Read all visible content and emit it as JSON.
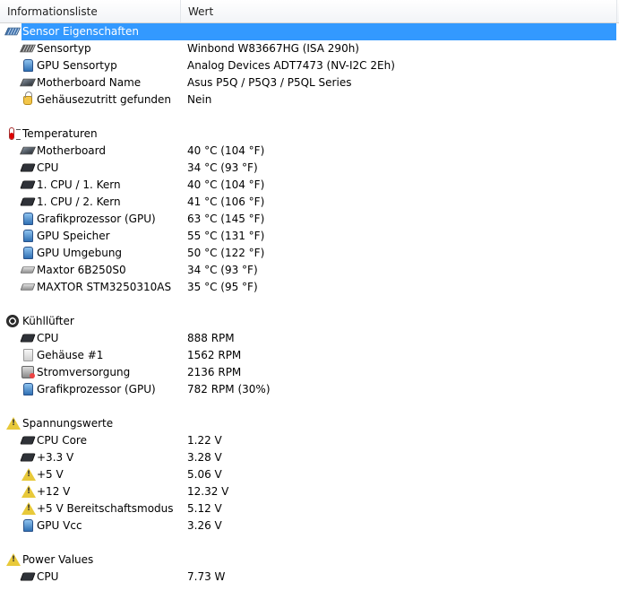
{
  "header": {
    "col_field": "Informationsliste",
    "col_value": "Wert"
  },
  "sections": [
    {
      "title": "Sensor Eigenschaften",
      "icon": "sensor-icon",
      "selected": true,
      "items": [
        {
          "label": "Sensortyp",
          "value": "Winbond W83667HG  (ISA 290h)",
          "icon": "sensor-chip-icon"
        },
        {
          "label": "GPU Sensortyp",
          "value": "Analog Devices ADT7473  (NV-I2C 2Eh)",
          "icon": "gpu-icon"
        },
        {
          "label": "Motherboard Name",
          "value": "Asus P5Q / P5Q3 / P5QL Series",
          "icon": "motherboard-icon"
        },
        {
          "label": "Gehäusezutritt gefunden",
          "value": "Nein",
          "icon": "lock-icon"
        }
      ]
    },
    {
      "title": "Temperaturen",
      "icon": "thermometer-icon",
      "items": [
        {
          "label": "Motherboard",
          "value": "40 °C  (104 °F)",
          "icon": "motherboard-icon"
        },
        {
          "label": "CPU",
          "value": "34 °C  (93 °F)",
          "icon": "cpu-icon"
        },
        {
          "label": "1. CPU / 1. Kern",
          "value": "40 °C  (104 °F)",
          "icon": "cpu-icon"
        },
        {
          "label": "1. CPU / 2. Kern",
          "value": "41 °C  (106 °F)",
          "icon": "cpu-icon"
        },
        {
          "label": "Grafikprozessor (GPU)",
          "value": "63 °C  (145 °F)",
          "icon": "gpu-icon"
        },
        {
          "label": "GPU Speicher",
          "value": "55 °C  (131 °F)",
          "icon": "gpu-icon"
        },
        {
          "label": "GPU Umgebung",
          "value": "50 °C  (122 °F)",
          "icon": "gpu-icon"
        },
        {
          "label": "Maxtor 6B250S0",
          "value": "34 °C  (93 °F)",
          "icon": "hard-disk-icon"
        },
        {
          "label": "MAXTOR STM3250310AS",
          "value": "35 °C  (95 °F)",
          "icon": "hard-disk-icon"
        }
      ]
    },
    {
      "title": "Kühllüfter",
      "icon": "fan-icon",
      "items": [
        {
          "label": "CPU",
          "value": "888 RPM",
          "icon": "cpu-icon"
        },
        {
          "label": "Gehäuse #1",
          "value": "1562 RPM",
          "icon": "case-icon"
        },
        {
          "label": "Stromversorgung",
          "value": "2136 RPM",
          "icon": "power-supply-icon"
        },
        {
          "label": "Grafikprozessor (GPU)",
          "value": "782 RPM  (30%)",
          "icon": "gpu-icon"
        }
      ]
    },
    {
      "title": "Spannungswerte",
      "icon": "warning-icon",
      "items": [
        {
          "label": "CPU Core",
          "value": "1.22 V",
          "icon": "cpu-icon"
        },
        {
          "label": "+3.3 V",
          "value": "3.28 V",
          "icon": "cpu-icon"
        },
        {
          "label": "+5 V",
          "value": "5.06 V",
          "icon": "warning-icon"
        },
        {
          "label": "+12 V",
          "value": "12.32 V",
          "icon": "warning-icon"
        },
        {
          "label": "+5 V Bereitschaftsmodus",
          "value": "5.12 V",
          "icon": "warning-icon"
        },
        {
          "label": "GPU Vcc",
          "value": "3.26 V",
          "icon": "gpu-icon"
        }
      ]
    },
    {
      "title": "Power Values",
      "icon": "warning-icon",
      "items": [
        {
          "label": "CPU",
          "value": "7.73 W",
          "icon": "cpu-icon"
        }
      ]
    }
  ]
}
